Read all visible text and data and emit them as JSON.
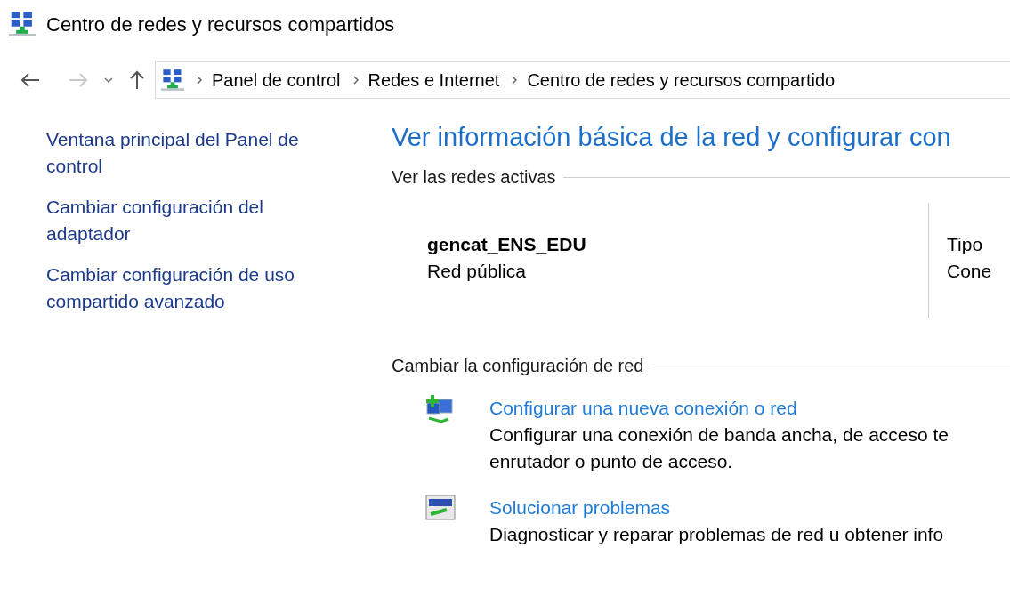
{
  "window": {
    "title": "Centro de redes y recursos compartidos"
  },
  "navigation": {
    "back_disabled": false,
    "forward_disabled": true,
    "breadcrumb": [
      "Panel de control",
      "Redes e Internet",
      "Centro de redes y recursos compartido"
    ]
  },
  "sidebar": {
    "links": [
      "Ventana principal del Panel de control",
      "Cambiar configuración del adaptador",
      "Cambiar configuración de uso compartido avanzado"
    ]
  },
  "main": {
    "heading": "Ver información básica de la red y configurar con",
    "active_networks": {
      "title": "Ver las redes activas",
      "name": "gencat_ENS_EDU",
      "type": "Red pública",
      "column_2": [
        "Tipo",
        "Cone"
      ]
    },
    "change_settings": {
      "title": "Cambiar la configuración de red",
      "tasks": [
        {
          "kind": "new-connection",
          "link": "Configurar una nueva conexión o red",
          "description": "Configurar una conexión de banda ancha, de acceso te\nenrutador o punto de acceso."
        },
        {
          "kind": "troubleshoot",
          "link": "Solucionar problemas",
          "description": "Diagnosticar y reparar problemas de red u obtener info"
        }
      ]
    }
  }
}
